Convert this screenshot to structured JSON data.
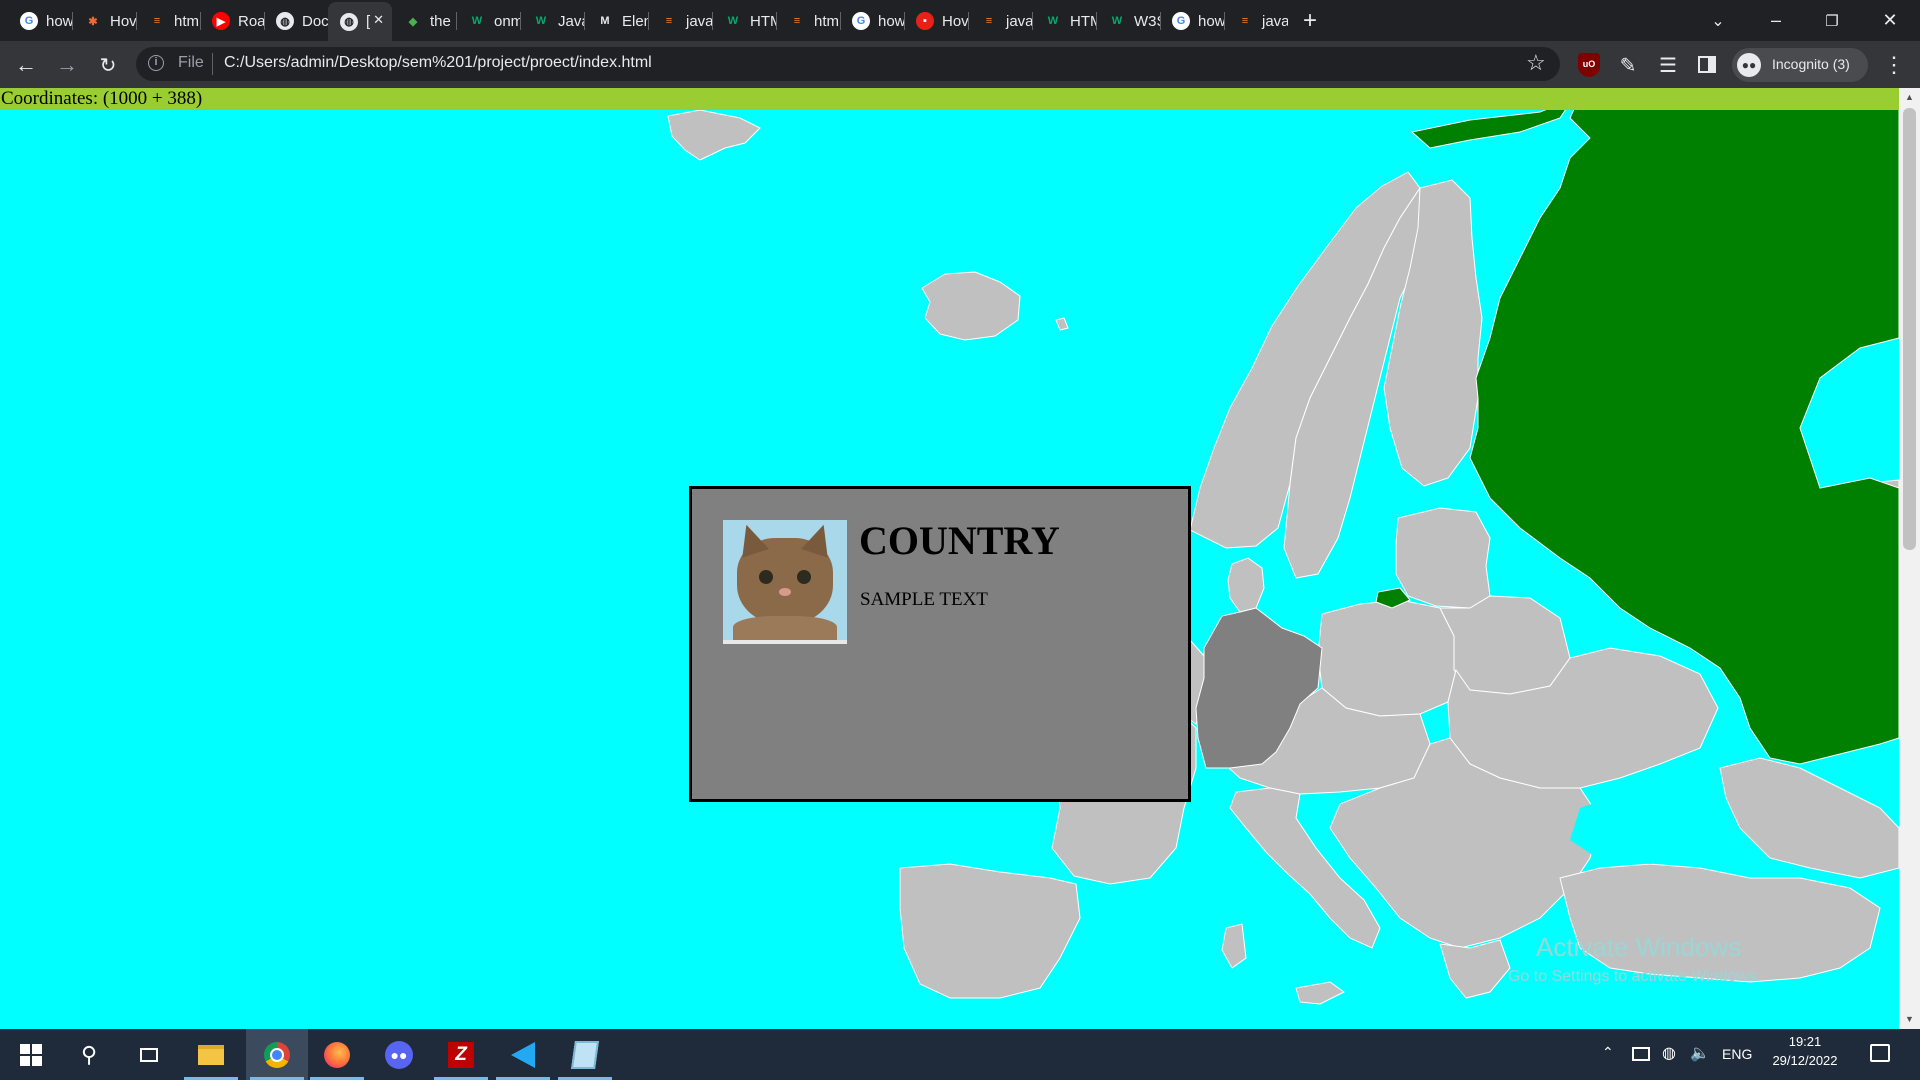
{
  "browser": {
    "tabs": [
      {
        "label": "how",
        "fav": "google-icon"
      },
      {
        "label": "Hov",
        "fav": "asterisk-icon"
      },
      {
        "label": "htm",
        "fav": "stackoverflow-icon"
      },
      {
        "label": "Roa",
        "fav": "youtube-icon"
      },
      {
        "label": "Doc",
        "fav": "globe-icon"
      },
      {
        "label": "[",
        "fav": "globe-icon",
        "active": true
      },
      {
        "label": "the",
        "fav": "layers-icon"
      },
      {
        "label": "onm",
        "fav": "w3schools-icon"
      },
      {
        "label": "Java",
        "fav": "w3schools-icon"
      },
      {
        "label": "Elen",
        "fav": "mdn-icon"
      },
      {
        "label": "java",
        "fav": "stackoverflow-icon"
      },
      {
        "label": "HTM",
        "fav": "w3schools-icon"
      },
      {
        "label": "htm",
        "fav": "stackoverflow-icon"
      },
      {
        "label": "how",
        "fav": "google-icon"
      },
      {
        "label": "Hov",
        "fav": "hub-icon"
      },
      {
        "label": "java",
        "fav": "stackoverflow-icon"
      },
      {
        "label": "HTM",
        "fav": "w3schools-icon"
      },
      {
        "label": "W3S",
        "fav": "w3schools-icon"
      },
      {
        "label": "how",
        "fav": "google-icon"
      },
      {
        "label": "java",
        "fav": "stackoverflow-icon"
      }
    ],
    "new_tab": "+",
    "address": {
      "scheme_label": "File",
      "url": "C:/Users/admin/Desktop/sem%201/project/proect/index.html"
    },
    "profile_label": "Incognito (3)",
    "colors": {
      "tabbar": "#202124",
      "toolbar": "#35363a",
      "text": "#e8eaed"
    }
  },
  "page": {
    "coordinates_text": "Coordinates: (1000 + 388)",
    "popup": {
      "title": "COUNTRY",
      "text": "SAMPLE TEXT"
    },
    "watermark": {
      "line1": "Activate Windows",
      "line2": "Go to Settings to activate Windows."
    },
    "colors": {
      "sea": "#00ffff",
      "land": "#c0c0c0",
      "selected": "#808080",
      "highlight": "#008000",
      "coordbar": "#9acd32",
      "popup": "#808080"
    }
  },
  "taskbar": {
    "apps": [
      "start-icon",
      "search-icon",
      "task-view-icon",
      "file-explorer-icon",
      "chrome-icon",
      "firefox-icon",
      "discord-icon",
      "filezilla-icon",
      "vscode-icon",
      "notepad-icon"
    ],
    "tray": {
      "language": "ENG",
      "time": "19:21",
      "date": "29/12/2022"
    }
  }
}
